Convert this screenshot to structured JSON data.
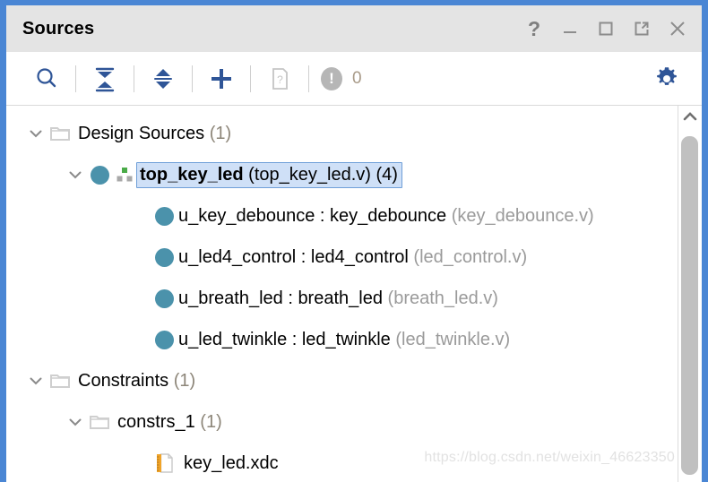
{
  "window": {
    "title": "Sources",
    "accent_color": "#4a86d4",
    "titlebar_bg": "#e4e4e4",
    "buttons": [
      {
        "name": "help",
        "glyph": "?"
      },
      {
        "name": "minimize",
        "glyph": "—"
      },
      {
        "name": "maximize",
        "glyph": "□"
      },
      {
        "name": "float",
        "glyph": "↗"
      },
      {
        "name": "close",
        "glyph": "✕"
      }
    ]
  },
  "toolbar": {
    "search_tooltip": "Search",
    "collapse_tooltip": "Collapse All",
    "expand_tooltip": "Expand All",
    "add_tooltip": "Add Sources",
    "report_tooltip": "Report",
    "settings_tooltip": "Settings",
    "issue_count": "0",
    "issue_glyph": "!"
  },
  "tree": {
    "nodes": [
      {
        "id": "design-sources",
        "indent": 0,
        "expanded": true,
        "icon": "folder-icon",
        "label": "Design Sources",
        "count": "(1)",
        "selected": false
      },
      {
        "id": "top-key-led",
        "indent": 1,
        "expanded": true,
        "icon": "module-hierarchy-icon",
        "label": "top_key_led",
        "file": "(top_key_led.v)",
        "count": "(4)",
        "selected": true
      },
      {
        "id": "u-key-debounce",
        "indent": 2,
        "expanded": null,
        "icon": "module-icon",
        "label": "u_key_debounce : key_debounce",
        "file": "(key_debounce.v)",
        "selected": false
      },
      {
        "id": "u-led4-control",
        "indent": 2,
        "expanded": null,
        "icon": "module-icon",
        "label": "u_led4_control : led4_control",
        "file": "(led_control.v)",
        "selected": false
      },
      {
        "id": "u-breath-led",
        "indent": 2,
        "expanded": null,
        "icon": "module-icon",
        "label": "u_breath_led : breath_led",
        "file": "(breath_led.v)",
        "selected": false
      },
      {
        "id": "u-led-twinkle",
        "indent": 2,
        "expanded": null,
        "icon": "module-icon",
        "label": "u_led_twinkle : led_twinkle",
        "file": "(led_twinkle.v)",
        "selected": false
      },
      {
        "id": "constraints",
        "indent": 0,
        "expanded": true,
        "icon": "folder-icon",
        "label": "Constraints",
        "count": "(1)",
        "selected": false
      },
      {
        "id": "constrs-1",
        "indent": 1,
        "expanded": true,
        "icon": "folder-icon",
        "label": "constrs_1",
        "count": "(1)",
        "selected": false
      },
      {
        "id": "key-led-xdc",
        "indent": 2,
        "expanded": null,
        "icon": "xdc-file-icon",
        "label": "key_led.xdc",
        "selected": false
      }
    ]
  },
  "scrollbar": {
    "up_tooltip": "Scroll up"
  },
  "watermark": {
    "text": "https://blog.csdn.net/weixin_46623350"
  }
}
